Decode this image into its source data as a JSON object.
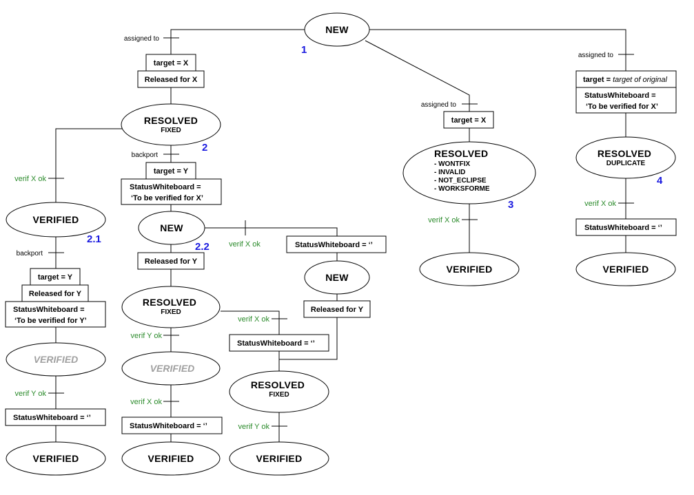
{
  "states": {
    "new_1": "NEW",
    "resolved_fixed_2": [
      "RESOLVED",
      "FIXED"
    ],
    "verified_2_1": "VERIFIED",
    "new_2_2": "NEW",
    "resolved_3": [
      "RESOLVED",
      "- WONTFIX",
      "- INVALID",
      "- NOT_ECLIPSE",
      "- WORKSFORME"
    ],
    "resolved_4": [
      "RESOLVED",
      "DUPLICATE"
    ],
    "verified_3": "VERIFIED",
    "verified_4": "VERIFIED",
    "new_right": "NEW",
    "resolved_fixed_mid": [
      "RESOLVED",
      "FIXED"
    ],
    "verified_grey_left": "VERIFIED",
    "verified_grey_mid": "VERIFIED",
    "resolved_fixed_right": [
      "RESOLVED",
      "FIXED"
    ],
    "verified_bottom_left": "VERIFIED",
    "verified_bottom_mid": "VERIFIED",
    "verified_bottom_right": "VERIFIED"
  },
  "boxes": {
    "target_x_1": "target = X",
    "released_x": "Released for X",
    "target_y_2": "target = Y",
    "sw_verify_x_2": [
      "StatusWhiteboard =",
      "‘To be verified for X’"
    ],
    "released_y_mid": "Released for Y",
    "sw_empty_right_top": "StatusWhiteboard = ‘’",
    "released_y_right": "Released for Y",
    "target_y_left": "target = Y",
    "released_y_left": "Released for Y",
    "sw_verify_y_left": [
      "StatusWhiteboard =",
      "‘To be verified for Y’"
    ],
    "sw_empty_left": "StatusWhiteboard = ‘’",
    "sw_empty_mid": "StatusWhiteboard = ‘’",
    "sw_empty_right": "StatusWhiteboard = ‘’",
    "target_x_3": "target = X",
    "target_orig_4": {
      "prefix": "target = ",
      "italic": "target of original"
    },
    "sw_verify_x_4": [
      "StatusWhiteboard =",
      "‘To be verified for X’"
    ],
    "sw_empty_4": "StatusWhiteboard = ‘’"
  },
  "transitions": {
    "assigned_to": "assigned to",
    "backport": "backport",
    "verif_x_ok": "verif X ok",
    "verif_y_ok": "verif Y ok"
  },
  "numbers": {
    "n1": "1",
    "n2": "2",
    "n2_1": "2.1",
    "n2_2": "2.2",
    "n3": "3",
    "n4": "4"
  },
  "colors": {
    "line": "#000000",
    "transition_label": "#2a8a2a",
    "number": "#1a1adf",
    "dimmed_state": "#a0a0a0"
  }
}
